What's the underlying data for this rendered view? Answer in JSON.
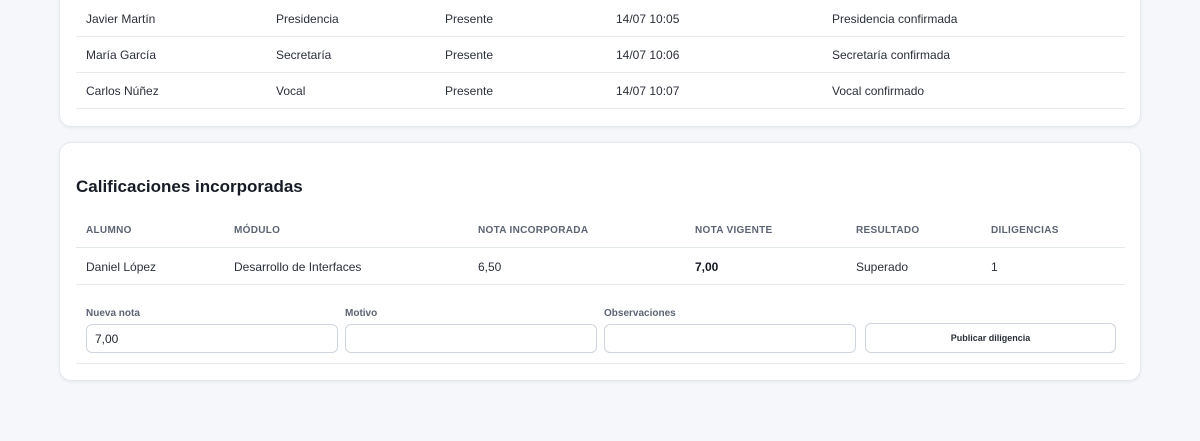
{
  "attendance": {
    "rows": [
      {
        "name": "Javier Martín",
        "role": "Presidencia",
        "status": "Presente",
        "time": "14/07 10:05",
        "note": "Presidencia confirmada"
      },
      {
        "name": "María García",
        "role": "Secretaría",
        "status": "Presente",
        "time": "14/07 10:06",
        "note": "Secretaría confirmada"
      },
      {
        "name": "Carlos Núñez",
        "role": "Vocal",
        "status": "Presente",
        "time": "14/07 10:07",
        "note": "Vocal confirmado"
      }
    ]
  },
  "grades": {
    "title": "Calificaciones incorporadas",
    "headers": {
      "student": "ALUMNO",
      "module": "MÓDULO",
      "incorporated": "NOTA INCORPORADA",
      "current": "NOTA VIGENTE",
      "result": "RESULTADO",
      "diligences": "DILIGENCIAS"
    },
    "rows": [
      {
        "student": "Daniel López",
        "module": "Desarrollo de Interfaces",
        "incorporated": "6,50",
        "current": "7,00",
        "result": "Superado",
        "diligences": "1"
      }
    ],
    "form": {
      "new_grade_label": "Nueva nota",
      "new_grade_value": "7,00",
      "reason_label": "Motivo",
      "reason_value": "",
      "observations_label": "Observaciones",
      "observations_value": "",
      "publish_label": "Publicar diligencia"
    }
  }
}
